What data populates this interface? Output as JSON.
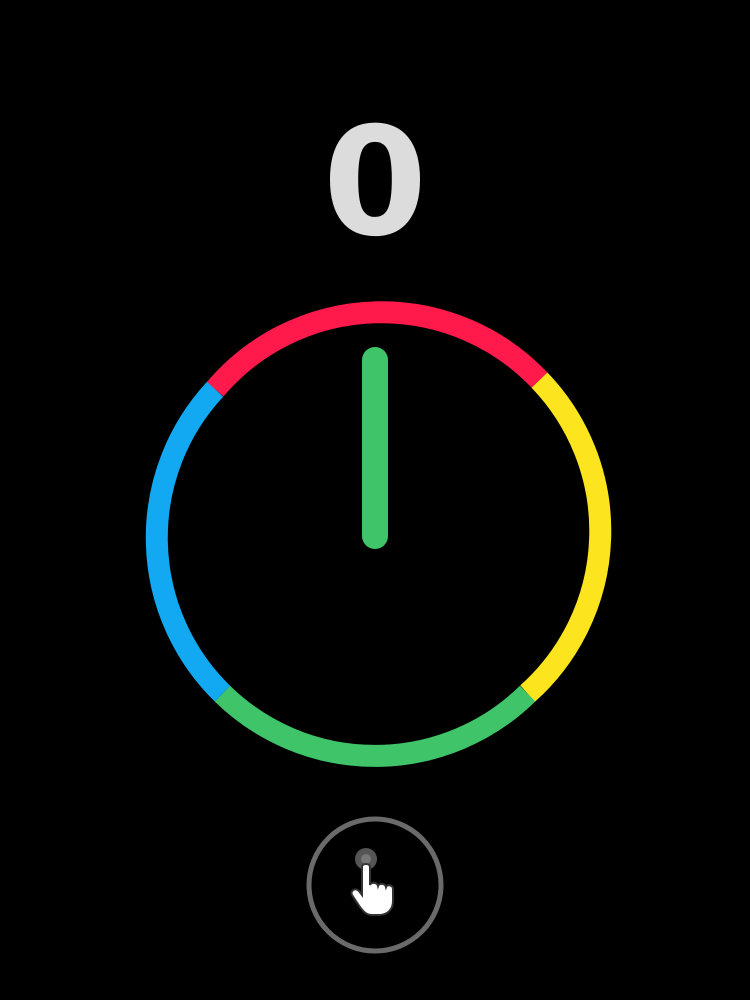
{
  "game": {
    "score": "0",
    "colors": {
      "background": "#000000",
      "score_text": "#dcdcdc",
      "red": "#ff1a4b",
      "yellow": "#fce51f",
      "green": "#3fc46a",
      "blue": "#12a9f2",
      "needle": "#3fc46a",
      "tap_ring": "#6a6a6a"
    },
    "wheel_segments": [
      {
        "color_name": "red"
      },
      {
        "color_name": "yellow"
      },
      {
        "color_name": "green"
      },
      {
        "color_name": "blue"
      }
    ],
    "needle_color_name": "green",
    "tap_icon": "tap-hand-icon"
  }
}
